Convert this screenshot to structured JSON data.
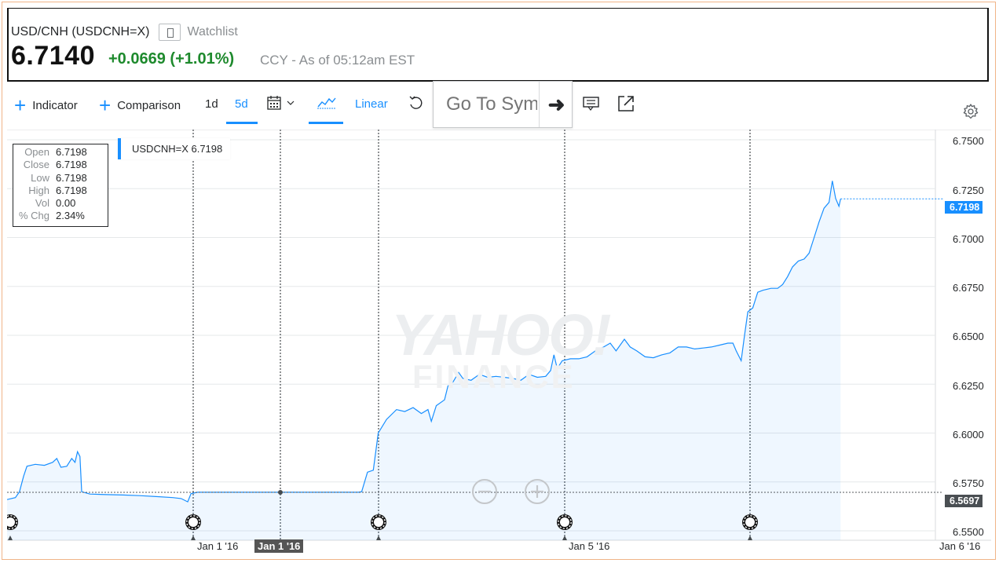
{
  "quote": {
    "symbol_line": "USD/CNH (USDCNH=X)",
    "watchlist_label": "Watchlist",
    "price": "6.7140",
    "change": "+0.0669",
    "change_pct": "(+1.01%)",
    "as_of": "CCY - As of 05:12am EST",
    "change_color": "#1e8a2d"
  },
  "toolbar": {
    "indicator_label": "Indicator",
    "comparison_label": "Comparison",
    "range_1d": "1d",
    "range_5d": "5d",
    "scale_label": "Linear",
    "goto_placeholder": "Go To Symbol",
    "icons": [
      "plus-icon",
      "calendar-icon",
      "chevron-down-icon",
      "line-chart-icon",
      "undo-icon",
      "arrow-right-icon",
      "annotate-icon",
      "share-icon",
      "gear-icon"
    ],
    "accent": "#188fff"
  },
  "ohlc": {
    "open_label": "Open",
    "open": "6.7198",
    "close_label": "Close",
    "close": "6.7198",
    "low_label": "Low",
    "low": "6.7198",
    "high_label": "High",
    "high": "6.7198",
    "vol_label": "Vol",
    "vol": "0.00",
    "chg_label": "% Chg",
    "chg": "2.34%"
  },
  "legend": {
    "text": "USDCNH=X 6.7198"
  },
  "tags": {
    "current": "6.7198",
    "prev_close": "6.5697"
  },
  "watermark": {
    "line1": "YAHOO!",
    "line2": "FINANCE"
  },
  "chart_data": {
    "type": "area",
    "series": [
      {
        "name": "USDCNH=X",
        "color": "#188fff",
        "points": [
          [
            0.0,
            6.566
          ],
          [
            0.1,
            6.567
          ],
          [
            0.15,
            6.57
          ],
          [
            0.2,
            6.578
          ],
          [
            0.24,
            6.583
          ],
          [
            0.34,
            6.584
          ],
          [
            0.45,
            6.5835
          ],
          [
            0.55,
            6.585
          ],
          [
            0.6,
            6.587
          ],
          [
            0.65,
            6.5825
          ],
          [
            0.72,
            6.583
          ],
          [
            0.78,
            6.587
          ],
          [
            0.82,
            6.585
          ],
          [
            0.85,
            6.5905
          ],
          [
            0.88,
            6.588
          ],
          [
            0.9,
            6.57
          ],
          [
            1.0,
            6.5688
          ],
          [
            1.2,
            6.5685
          ],
          [
            1.4,
            6.5683
          ],
          [
            1.6,
            6.568
          ],
          [
            1.8,
            6.5675
          ],
          [
            2.0,
            6.567
          ],
          [
            2.1,
            6.5665
          ],
          [
            2.18,
            6.5648
          ],
          [
            2.22,
            6.569
          ],
          [
            2.3,
            6.5697
          ],
          [
            3.2,
            6.5697
          ],
          [
            4.24,
            6.5697
          ],
          [
            4.28,
            6.57
          ],
          [
            4.35,
            6.58
          ],
          [
            4.42,
            6.581
          ],
          [
            4.48,
            6.6
          ],
          [
            4.58,
            6.607
          ],
          [
            4.7,
            6.612
          ],
          [
            4.8,
            6.611
          ],
          [
            4.9,
            6.613
          ],
          [
            5.0,
            6.61
          ],
          [
            5.08,
            6.612
          ],
          [
            5.12,
            6.606
          ],
          [
            5.18,
            6.614
          ],
          [
            5.28,
            6.617
          ],
          [
            5.32,
            6.624
          ],
          [
            5.38,
            6.626
          ],
          [
            5.45,
            6.631
          ],
          [
            5.5,
            6.628
          ],
          [
            5.6,
            6.627
          ],
          [
            5.7,
            6.63
          ],
          [
            5.8,
            6.6285
          ],
          [
            5.9,
            6.629
          ],
          [
            6.0,
            6.6285
          ],
          [
            6.1,
            6.628
          ],
          [
            6.2,
            6.627
          ],
          [
            6.3,
            6.63
          ],
          [
            6.4,
            6.6285
          ],
          [
            6.5,
            6.629
          ],
          [
            6.56,
            6.632
          ],
          [
            6.6,
            6.64
          ],
          [
            6.64,
            6.633
          ],
          [
            6.7,
            6.637
          ],
          [
            6.8,
            6.638
          ],
          [
            6.9,
            6.638
          ],
          [
            7.0,
            6.639
          ],
          [
            7.1,
            6.642
          ],
          [
            7.2,
            6.644
          ],
          [
            7.28,
            6.646
          ],
          [
            7.35,
            6.642
          ],
          [
            7.45,
            6.648
          ],
          [
            7.52,
            6.644
          ],
          [
            7.6,
            6.642
          ],
          [
            7.7,
            6.639
          ],
          [
            7.8,
            6.6385
          ],
          [
            7.9,
            6.64
          ],
          [
            8.0,
            6.641
          ],
          [
            8.1,
            6.644
          ],
          [
            8.2,
            6.644
          ],
          [
            8.3,
            6.643
          ],
          [
            8.4,
            6.6435
          ],
          [
            8.5,
            6.644
          ],
          [
            8.6,
            6.645
          ],
          [
            8.7,
            6.646
          ],
          [
            8.76,
            6.646
          ],
          [
            8.8,
            6.642
          ],
          [
            8.86,
            6.637
          ],
          [
            8.9,
            6.65
          ],
          [
            8.94,
            6.662
          ],
          [
            9.0,
            6.664
          ],
          [
            9.06,
            6.672
          ],
          [
            9.12,
            6.673
          ],
          [
            9.22,
            6.674
          ],
          [
            9.3,
            6.674
          ],
          [
            9.36,
            6.676
          ],
          [
            9.42,
            6.68
          ],
          [
            9.48,
            6.685
          ],
          [
            9.55,
            6.688
          ],
          [
            9.62,
            6.689
          ],
          [
            9.68,
            6.692
          ],
          [
            9.74,
            6.7
          ],
          [
            9.8,
            6.708
          ],
          [
            9.86,
            6.715
          ],
          [
            9.92,
            6.718
          ],
          [
            9.96,
            6.729
          ],
          [
            10.0,
            6.72
          ],
          [
            10.04,
            6.716
          ],
          [
            10.06,
            6.7198
          ]
        ]
      }
    ],
    "y_ticks": [
      "6.7500",
      "6.7250",
      "6.7000",
      "6.6750",
      "6.6500",
      "6.6250",
      "6.6000",
      "6.5750",
      "6.5500"
    ],
    "ylim": [
      6.55,
      6.75
    ],
    "x_ticks": [
      "Jan 1 '16",
      "Jan 5 '16",
      "Jan 6 '16"
    ],
    "x_highlight": "Jan 1 '16",
    "prev_close": 6.5697,
    "current": 6.7198
  }
}
